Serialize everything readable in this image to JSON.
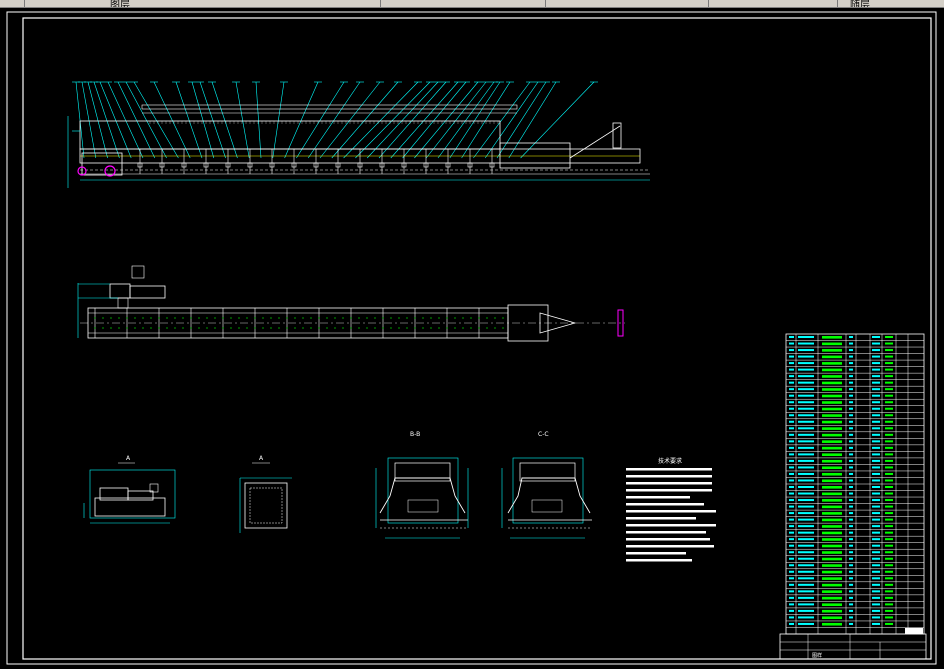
{
  "toolbar": {
    "layer_label": "图层",
    "right_label": "随层"
  },
  "drawing": {
    "section_marks": [
      "A",
      "A",
      "B-B",
      "C-C"
    ],
    "notes_title": "技术要求",
    "colors": {
      "background": "#000000",
      "frame": "#ffffff",
      "dimension": "#00ffff",
      "text_fill": "#00ff00",
      "magenta": "#ff00ff",
      "yellow": "#ffff00"
    }
  },
  "title_block": {
    "label": "图样"
  }
}
